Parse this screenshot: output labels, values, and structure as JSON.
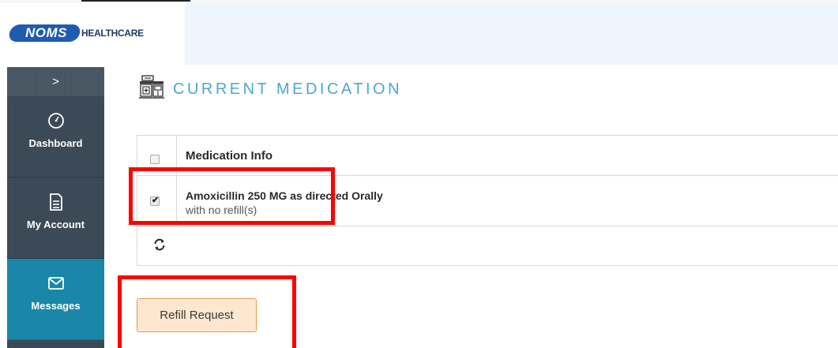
{
  "header": {
    "logo_pill": "NOMS",
    "logo_text": "HEALTHCARE"
  },
  "sidebar": {
    "toggle_label": ">",
    "items": [
      {
        "label": "Dashboard",
        "icon": "gauge-icon",
        "active": false
      },
      {
        "label": "My Account",
        "icon": "document-icon",
        "active": false
      },
      {
        "label": "Messages",
        "icon": "envelope-icon",
        "active": true
      }
    ]
  },
  "main": {
    "title": "CURRENT MEDICATION",
    "title_icon": "pharmacy-icon",
    "table": {
      "column_header": "Medication Info",
      "header_checked": false,
      "rows": [
        {
          "name": "Amoxicillin 250 MG as directed Orally",
          "refills": "with no refill(s)",
          "checked": true
        }
      ],
      "refresh_icon": "refresh-icon"
    },
    "refill_button": "Refill Request"
  },
  "colors": {
    "sidebar_bg": "#3c4a57",
    "sidebar_active": "#1a87a8",
    "title_accent": "#4aa8d4",
    "button_bg": "#fde7cf",
    "button_border": "#e59a4a",
    "highlight": "#ff0000",
    "logo_blue": "#1f5bb0"
  }
}
